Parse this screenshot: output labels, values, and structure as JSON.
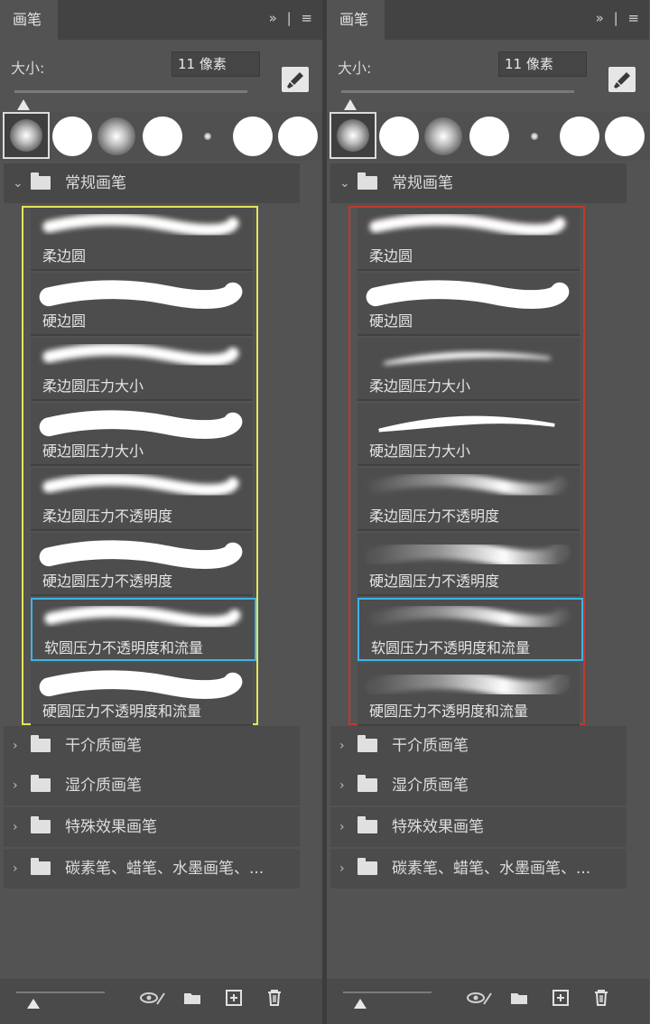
{
  "panels": [
    {
      "tab": "画笔",
      "header_controls": "» | ≡",
      "size_label": "大小:",
      "size_value": "11 像素",
      "group_open": "常规画笔",
      "brushes": [
        {
          "label": "柔边圆",
          "kind": "soft"
        },
        {
          "label": "硬边圆",
          "kind": "hard"
        },
        {
          "label": "柔边圆压力大小",
          "kind": "soft"
        },
        {
          "label": "硬边圆压力大小",
          "kind": "hard"
        },
        {
          "label": "柔边圆压力不透明度",
          "kind": "soft"
        },
        {
          "label": "硬边圆压力不透明度",
          "kind": "hard"
        },
        {
          "label": "软圆压力不透明度和流量",
          "kind": "soft"
        },
        {
          "label": "硬圆压力不透明度和流量",
          "kind": "hard"
        }
      ],
      "highlight_index": 6,
      "frame_color": "#e3e55a",
      "other_groups": [
        "干介质画笔",
        "湿介质画笔",
        "特殊效果画笔",
        "碳素笔、蜡笔、水墨画笔、..."
      ]
    },
    {
      "tab": "画笔",
      "header_controls": "» | ≡",
      "size_label": "大小:",
      "size_value": "11 像素",
      "group_open": "常规画笔",
      "brushes": [
        {
          "label": "柔边圆",
          "kind": "soft"
        },
        {
          "label": "硬边圆",
          "kind": "hard"
        },
        {
          "label": "柔边圆压力大小",
          "kind": "taper-soft"
        },
        {
          "label": "硬边圆压力大小",
          "kind": "taper-hard"
        },
        {
          "label": "柔边圆压力不透明度",
          "kind": "fade-soft"
        },
        {
          "label": "硬边圆压力不透明度",
          "kind": "fade-hard"
        },
        {
          "label": "软圆压力不透明度和流量",
          "kind": "fade-soft"
        },
        {
          "label": "硬圆压力不透明度和流量",
          "kind": "fade-hard"
        }
      ],
      "highlight_index": 6,
      "frame_color": "#c0392b",
      "other_groups": [
        "干介质画笔",
        "湿介质画笔",
        "特殊效果画笔",
        "碳素笔、蜡笔、水墨画笔、..."
      ]
    }
  ],
  "icons": {
    "brush_settings": "brush-settings-icon",
    "visibility": "visibility-icon",
    "new_folder": "folder-icon",
    "new_brush": "new-brush-icon",
    "delete": "trash-icon"
  }
}
